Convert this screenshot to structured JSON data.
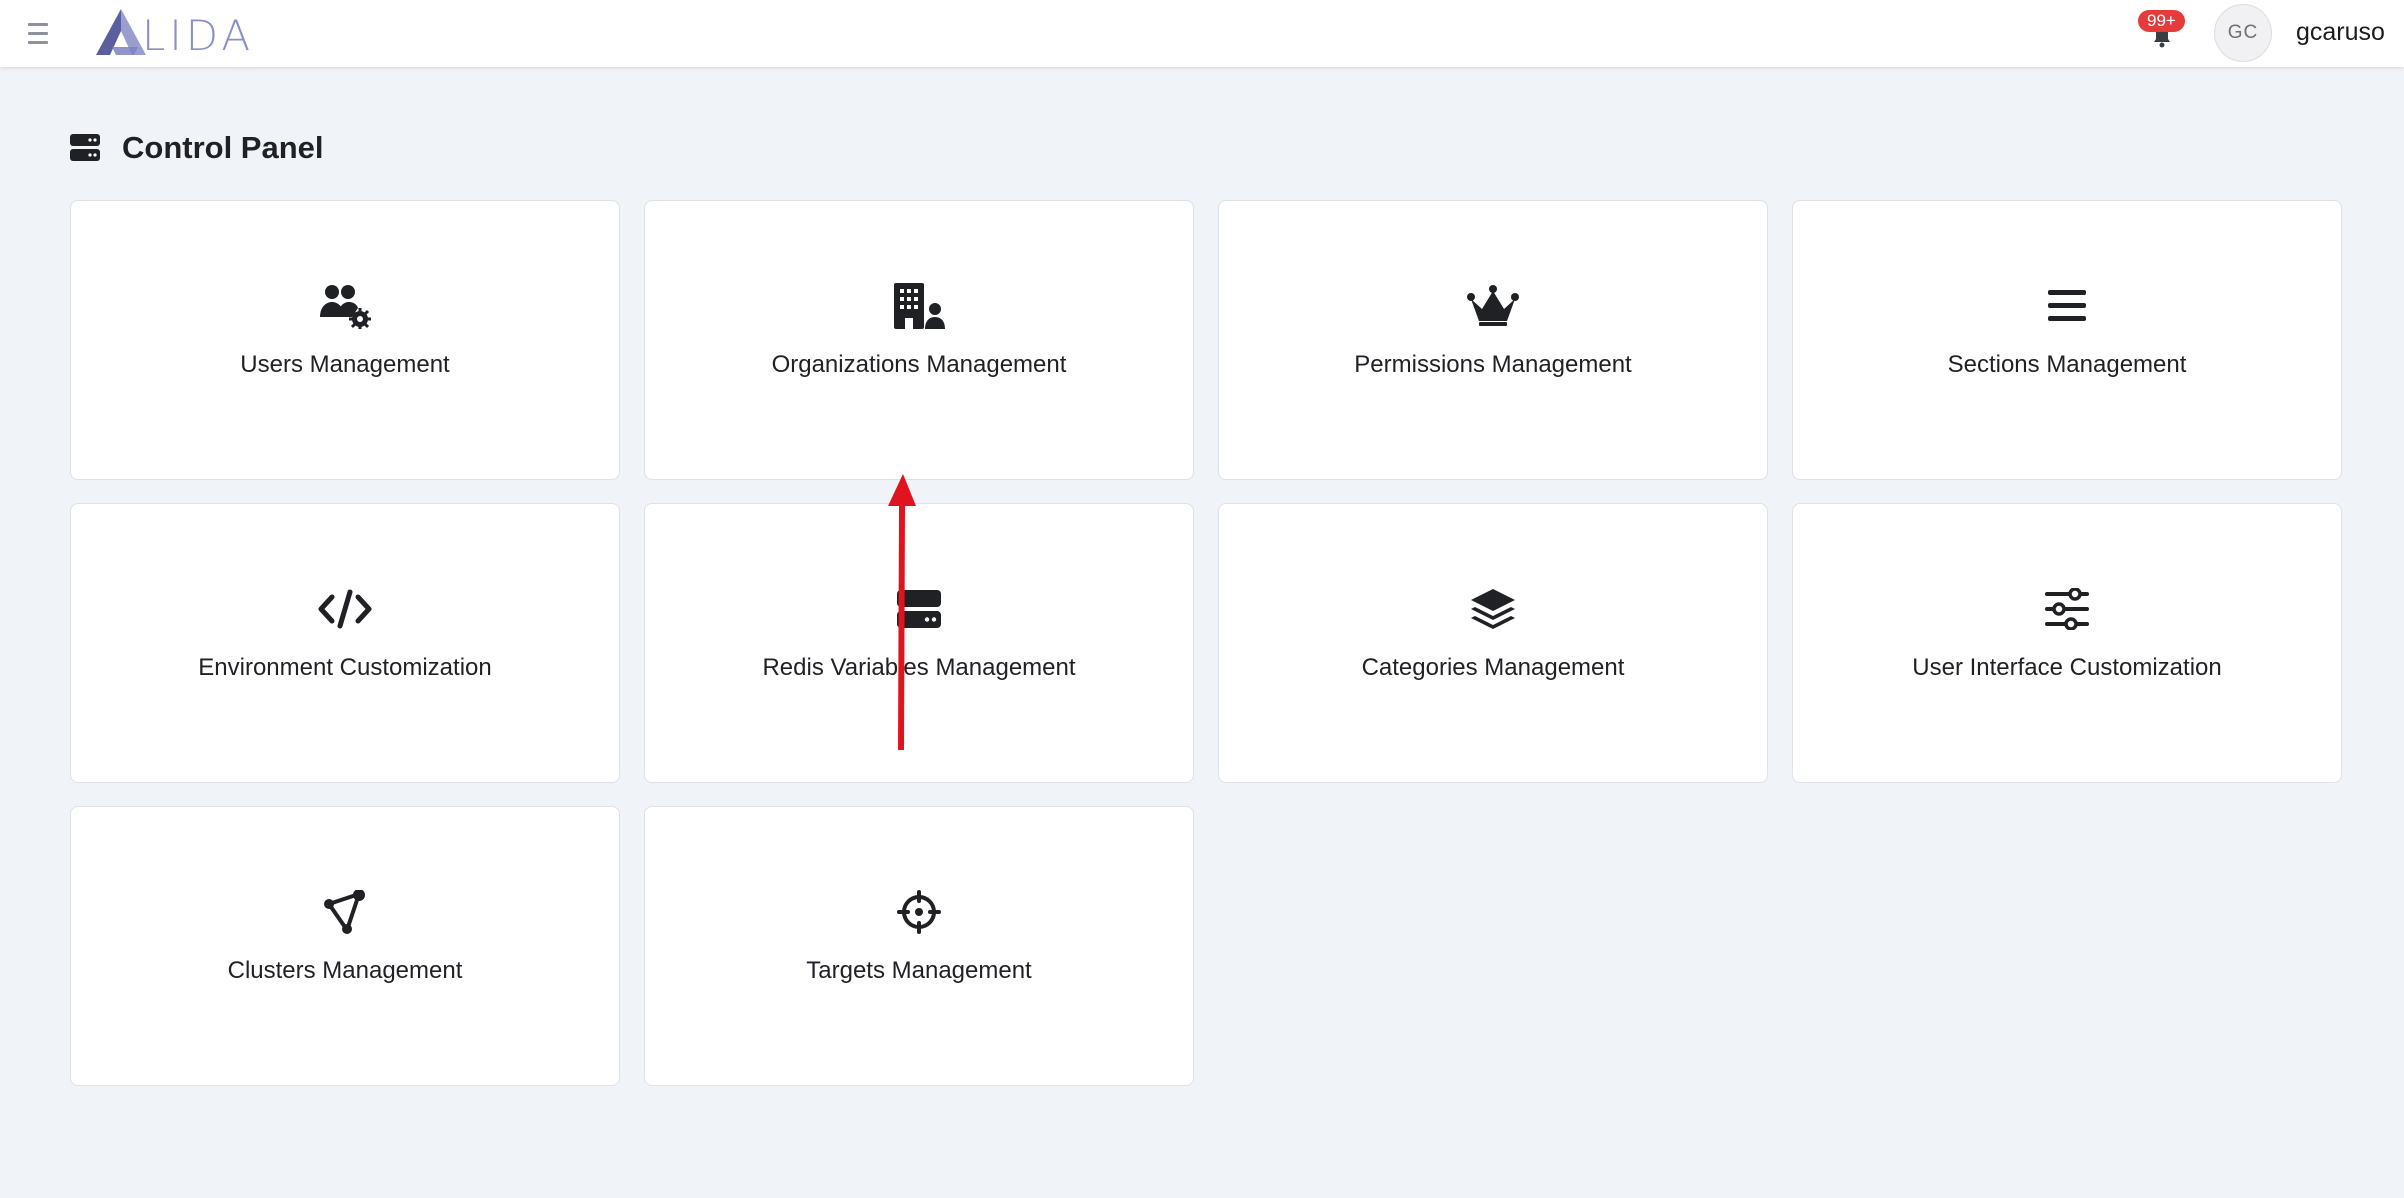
{
  "header": {
    "logo_text": "LIDA",
    "notification_badge": "99+",
    "avatar_initials": "GC",
    "username": "gcaruso"
  },
  "page": {
    "title": "Control Panel",
    "title_icon": "server-icon"
  },
  "cards": [
    {
      "label": "Users Management",
      "icon": "users-cog-icon"
    },
    {
      "label": "Organizations Management",
      "icon": "building-user-icon"
    },
    {
      "label": "Permissions Management",
      "icon": "crown-icon"
    },
    {
      "label": "Sections Management",
      "icon": "bars-icon"
    },
    {
      "label": "Environment Customization",
      "icon": "code-icon"
    },
    {
      "label": "Redis Variables Management",
      "icon": "server-icon"
    },
    {
      "label": "Categories Management",
      "icon": "layer-group-icon"
    },
    {
      "label": "User Interface Customization",
      "icon": "sliders-icon"
    },
    {
      "label": "Clusters Management",
      "icon": "cluster-icon"
    },
    {
      "label": "Targets Management",
      "icon": "crosshairs-icon"
    }
  ],
  "colors": {
    "background": "#f0f3f8",
    "badge": "#e63b3b",
    "logo": "#8a8fc6",
    "annotation_arrow": "#e0141e"
  }
}
